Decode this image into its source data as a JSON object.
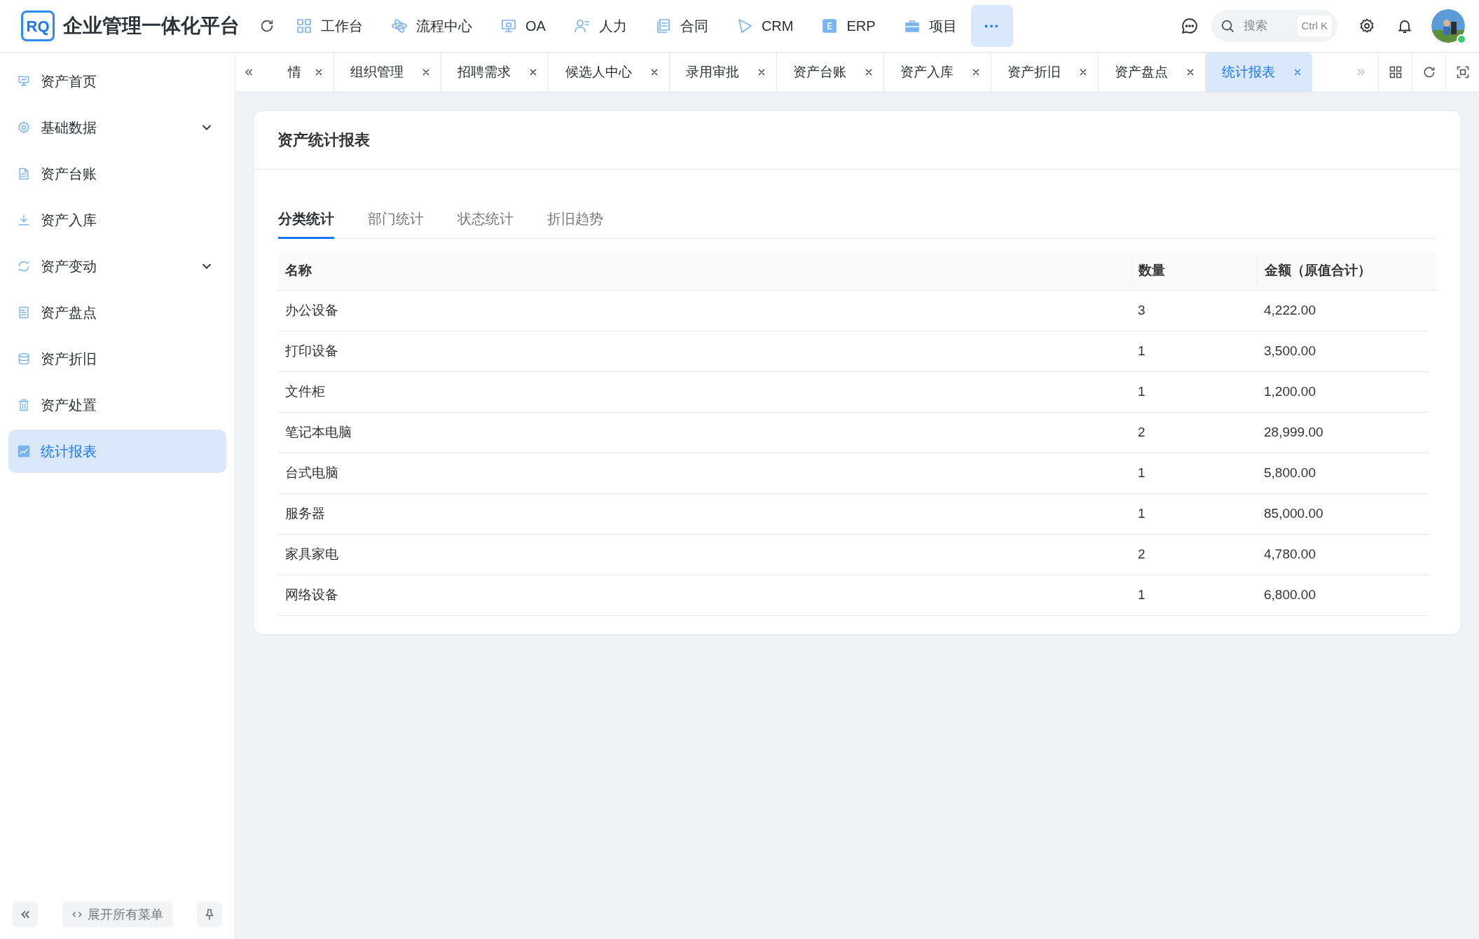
{
  "header": {
    "logo": "RQ",
    "title": "企业管理一体化平台",
    "nav": [
      {
        "label": "工作台"
      },
      {
        "label": "流程中心"
      },
      {
        "label": "OA"
      },
      {
        "label": "人力"
      },
      {
        "label": "合同"
      },
      {
        "label": "CRM"
      },
      {
        "label": "ERP"
      },
      {
        "label": "项目"
      }
    ],
    "more": "···",
    "search": {
      "placeholder": "搜索",
      "shortcut": "Ctrl K"
    }
  },
  "sidebar": {
    "items": [
      {
        "label": "资产首页",
        "kind": "item",
        "selected": false
      },
      {
        "label": "基础数据",
        "kind": "group",
        "expanded": false,
        "selected": false
      },
      {
        "label": "资产台账",
        "kind": "item",
        "selected": false
      },
      {
        "label": "资产入库",
        "kind": "item",
        "selected": false
      },
      {
        "label": "资产变动",
        "kind": "group",
        "expanded": false,
        "selected": false
      },
      {
        "label": "资产盘点",
        "kind": "item",
        "selected": false
      },
      {
        "label": "资产折旧",
        "kind": "item",
        "selected": false
      },
      {
        "label": "资产处置",
        "kind": "item",
        "selected": false
      },
      {
        "label": "统计报表",
        "kind": "item",
        "selected": true
      }
    ],
    "expand_all": "展开所有菜单"
  },
  "tabs": [
    {
      "label": "情",
      "selected": false
    },
    {
      "label": "组织管理",
      "selected": false
    },
    {
      "label": "招聘需求",
      "selected": false
    },
    {
      "label": "候选人中心",
      "selected": false
    },
    {
      "label": "录用审批",
      "selected": false
    },
    {
      "label": "资产台账",
      "selected": false
    },
    {
      "label": "资产入库",
      "selected": false
    },
    {
      "label": "资产折旧",
      "selected": false
    },
    {
      "label": "资产盘点",
      "selected": false
    },
    {
      "label": "统计报表",
      "selected": true
    }
  ],
  "card": {
    "title": "资产统计报表",
    "tabs": [
      {
        "label": "分类统计",
        "selected": true
      },
      {
        "label": "部门统计",
        "selected": false
      },
      {
        "label": "状态统计",
        "selected": false
      },
      {
        "label": "折旧趋势",
        "selected": false
      }
    ],
    "table": {
      "columns": [
        "名称",
        "数量",
        "金额（原值合计）"
      ],
      "rows": [
        [
          "办公设备",
          "3",
          "4,222.00"
        ],
        [
          "打印设备",
          "1",
          "3,500.00"
        ],
        [
          "文件柜",
          "1",
          "1,200.00"
        ],
        [
          "笔记本电脑",
          "2",
          "28,999.00"
        ],
        [
          "台式电脑",
          "1",
          "5,800.00"
        ],
        [
          "服务器",
          "1",
          "85,000.00"
        ],
        [
          "家具家电",
          "2",
          "4,780.00"
        ],
        [
          "网络设备",
          "1",
          "6,800.00"
        ]
      ]
    }
  }
}
